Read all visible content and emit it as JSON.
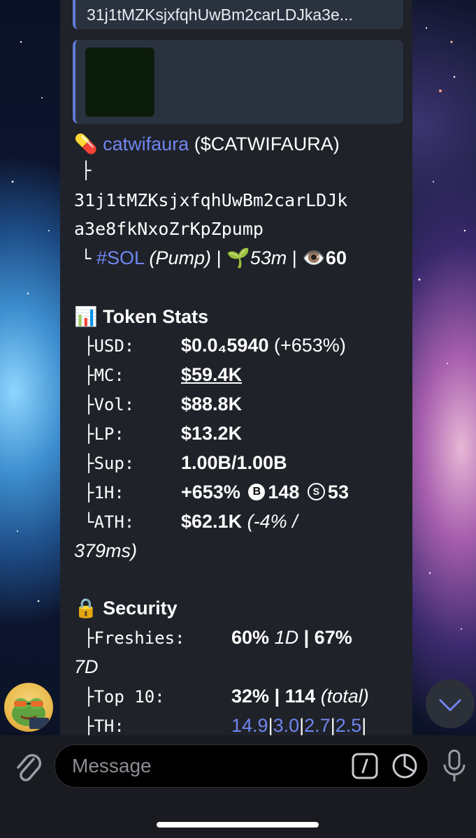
{
  "reply_top": {
    "text": "31j1tMZKsjxfqhUwBm2carLDJka3e..."
  },
  "token": {
    "emoji": "💊",
    "name": "catwifaura",
    "ticker": "($CATWIFAURA)",
    "branch": "├",
    "address_line1": "31j1tMZKsjxfqhUwBm2carLDJk",
    "address_line2": "a3e8fkNxoZrKpZpump",
    "meta_prefix": "└",
    "chain": "#SOL",
    "platform": "(Pump)",
    "sep": "|",
    "age_emoji": "🌱",
    "age": "53m",
    "views_emoji": "👁️",
    "views": "60"
  },
  "stats": {
    "header_emoji": "📊",
    "header": "Token Stats",
    "rows": [
      {
        "prefix": "├",
        "label": "USD:",
        "value": "$0.0₄5940",
        "extra": "(+653%)"
      },
      {
        "prefix": "├",
        "label": "MC:",
        "value": "$59.4K"
      },
      {
        "prefix": "├",
        "label": "Vol:",
        "value": "$88.8K"
      },
      {
        "prefix": "├",
        "label": "LP:",
        "value": "$13.2K"
      },
      {
        "prefix": "├",
        "label": "Sup:",
        "value": "1.00B/1.00B"
      },
      {
        "prefix": "├",
        "label": "1H:",
        "value": "+653%",
        "b_icon": "B",
        "buys": "148",
        "s_icon": "S",
        "sells": "53"
      },
      {
        "prefix": "└",
        "label": "ATH:",
        "value": "$62.1K",
        "extra": "(-4% /",
        "extra2": "379ms)"
      }
    ]
  },
  "security": {
    "header_emoji": "🔒",
    "header": "Security",
    "freshies": {
      "prefix": "├",
      "label": "Freshies:",
      "v1": "60%",
      "p1": "1D",
      "sep": "|",
      "v2": "67%",
      "p2": "7D"
    },
    "top10": {
      "prefix": "├",
      "label": "Top 10:",
      "value": "32%",
      "sep": "|",
      "count": "114",
      "note": "(total)"
    },
    "th": {
      "prefix": "├",
      "label": "TH:",
      "values": [
        "14.9",
        "3.0",
        "2.7",
        "2.5"
      ],
      "sep": "|"
    }
  },
  "composer": {
    "placeholder": "Message",
    "attach_icon": "paperclip-icon",
    "command_icon": "slash-command-icon",
    "sticker_icon": "sticker-icon",
    "mic_icon": "microphone-icon"
  },
  "scroll_icon": "chevron-down-icon",
  "colors": {
    "accent": "#6f86f0",
    "bubble": "#1f2229",
    "reply_bar": "#5f7bd6"
  }
}
